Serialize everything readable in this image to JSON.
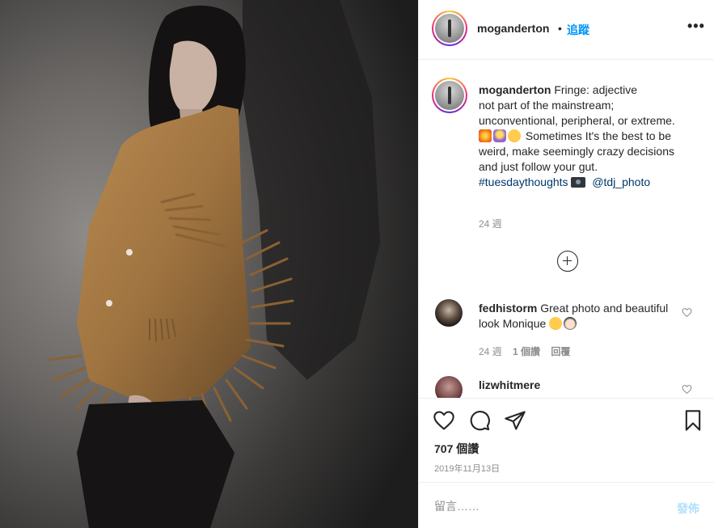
{
  "post": {
    "username": "moganderton",
    "dot": "•",
    "follow_label": "追蹤",
    "more_label": "•••"
  },
  "caption": {
    "username": "moganderton",
    "line1": "Fringe: adjective",
    "line2": "not part of the mainstream; unconventional, peripheral, or extreme.",
    "line3": "Sometimes It's the best to be weird, make seemingly crazy decisions and just follow your gut.",
    "hashtag": "#tuesdaythoughts",
    "mention": "@tdj_photo",
    "emojis": [
      "collision-icon",
      "woman-tipping-hand-icon",
      "hugging-face-icon",
      "camera-icon"
    ],
    "time": "24 週"
  },
  "comments": [
    {
      "username": "fedhistorm",
      "text": "Great photo and beautiful look Monique",
      "time": "24 週",
      "likes": "1 個讚",
      "reply": "回覆",
      "emojis": [
        "smirking-face-icon",
        "girl-icon"
      ]
    },
    {
      "username": "lizwhitmere"
    }
  ],
  "actions": {
    "likes": "707 個讚",
    "date": "2019年11月13日"
  },
  "comment_box": {
    "placeholder": "留言……",
    "post_label": "發佈"
  },
  "colors": {
    "link_blue": "#0095f6",
    "hashtag": "#00376b",
    "muted": "#8e8e8e",
    "text": "#262626",
    "post_disabled": "#b2dffc"
  }
}
